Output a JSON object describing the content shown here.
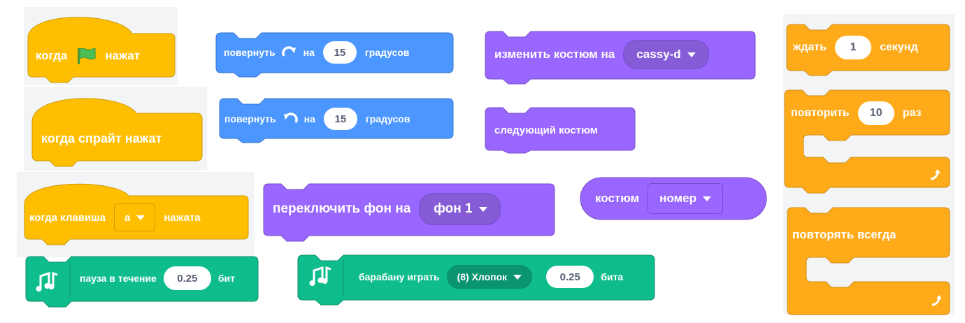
{
  "colors": {
    "events": "#ffbf00",
    "events_border": "#cc9900",
    "motion": "#4c97ff",
    "motion_border": "#3373cc",
    "looks": "#9966ff",
    "looks_border": "#774dcb",
    "looks_dark": "#855cd6",
    "control": "#ffab19",
    "control_border": "#cf8b17",
    "music": "#0fbd8c",
    "music_border": "#0b8e69",
    "music_dark": "#0b9470",
    "flag": "#4cbf56"
  },
  "icons": [
    "green-flag-icon",
    "rotate-right-icon",
    "rotate-left-icon",
    "dropdown-caret-icon",
    "loop-arrow-icon",
    "music-notes-icon"
  ],
  "events": {
    "when_flag": {
      "before": "когда",
      "after": "нажат"
    },
    "when_sprite": {
      "label": "когда спрайт нажат"
    },
    "when_key": {
      "before": "когда клавиша",
      "key": "a",
      "after": "нажата"
    }
  },
  "motion": {
    "turn_right": {
      "verb": "повернуть",
      "on": "на",
      "value": "15",
      "unit": "градусов"
    },
    "turn_left": {
      "verb": "повернуть",
      "on": "на",
      "value": "15",
      "unit": "градусов"
    }
  },
  "looks": {
    "switch_costume": {
      "label": "изменить костюм на",
      "value": "cassy-d"
    },
    "next_costume": {
      "label": "следующий костюм"
    },
    "switch_backdrop": {
      "label": "переключить фон на",
      "value": "фон 1"
    },
    "costume_reporter": {
      "label": "костюм",
      "value": "номер"
    }
  },
  "control": {
    "wait": {
      "before": "ждать",
      "value": "1",
      "after": "секунд"
    },
    "repeat": {
      "before": "повторить",
      "value": "10",
      "after": "раз"
    },
    "forever": {
      "label": "повторять всегда"
    }
  },
  "music": {
    "rest": {
      "before": "пауза в течение",
      "value": "0.25",
      "after": "бит"
    },
    "drum": {
      "before": "барабану играть",
      "drum": "(8) Хлопок",
      "value": "0.25",
      "after": "бита"
    }
  }
}
